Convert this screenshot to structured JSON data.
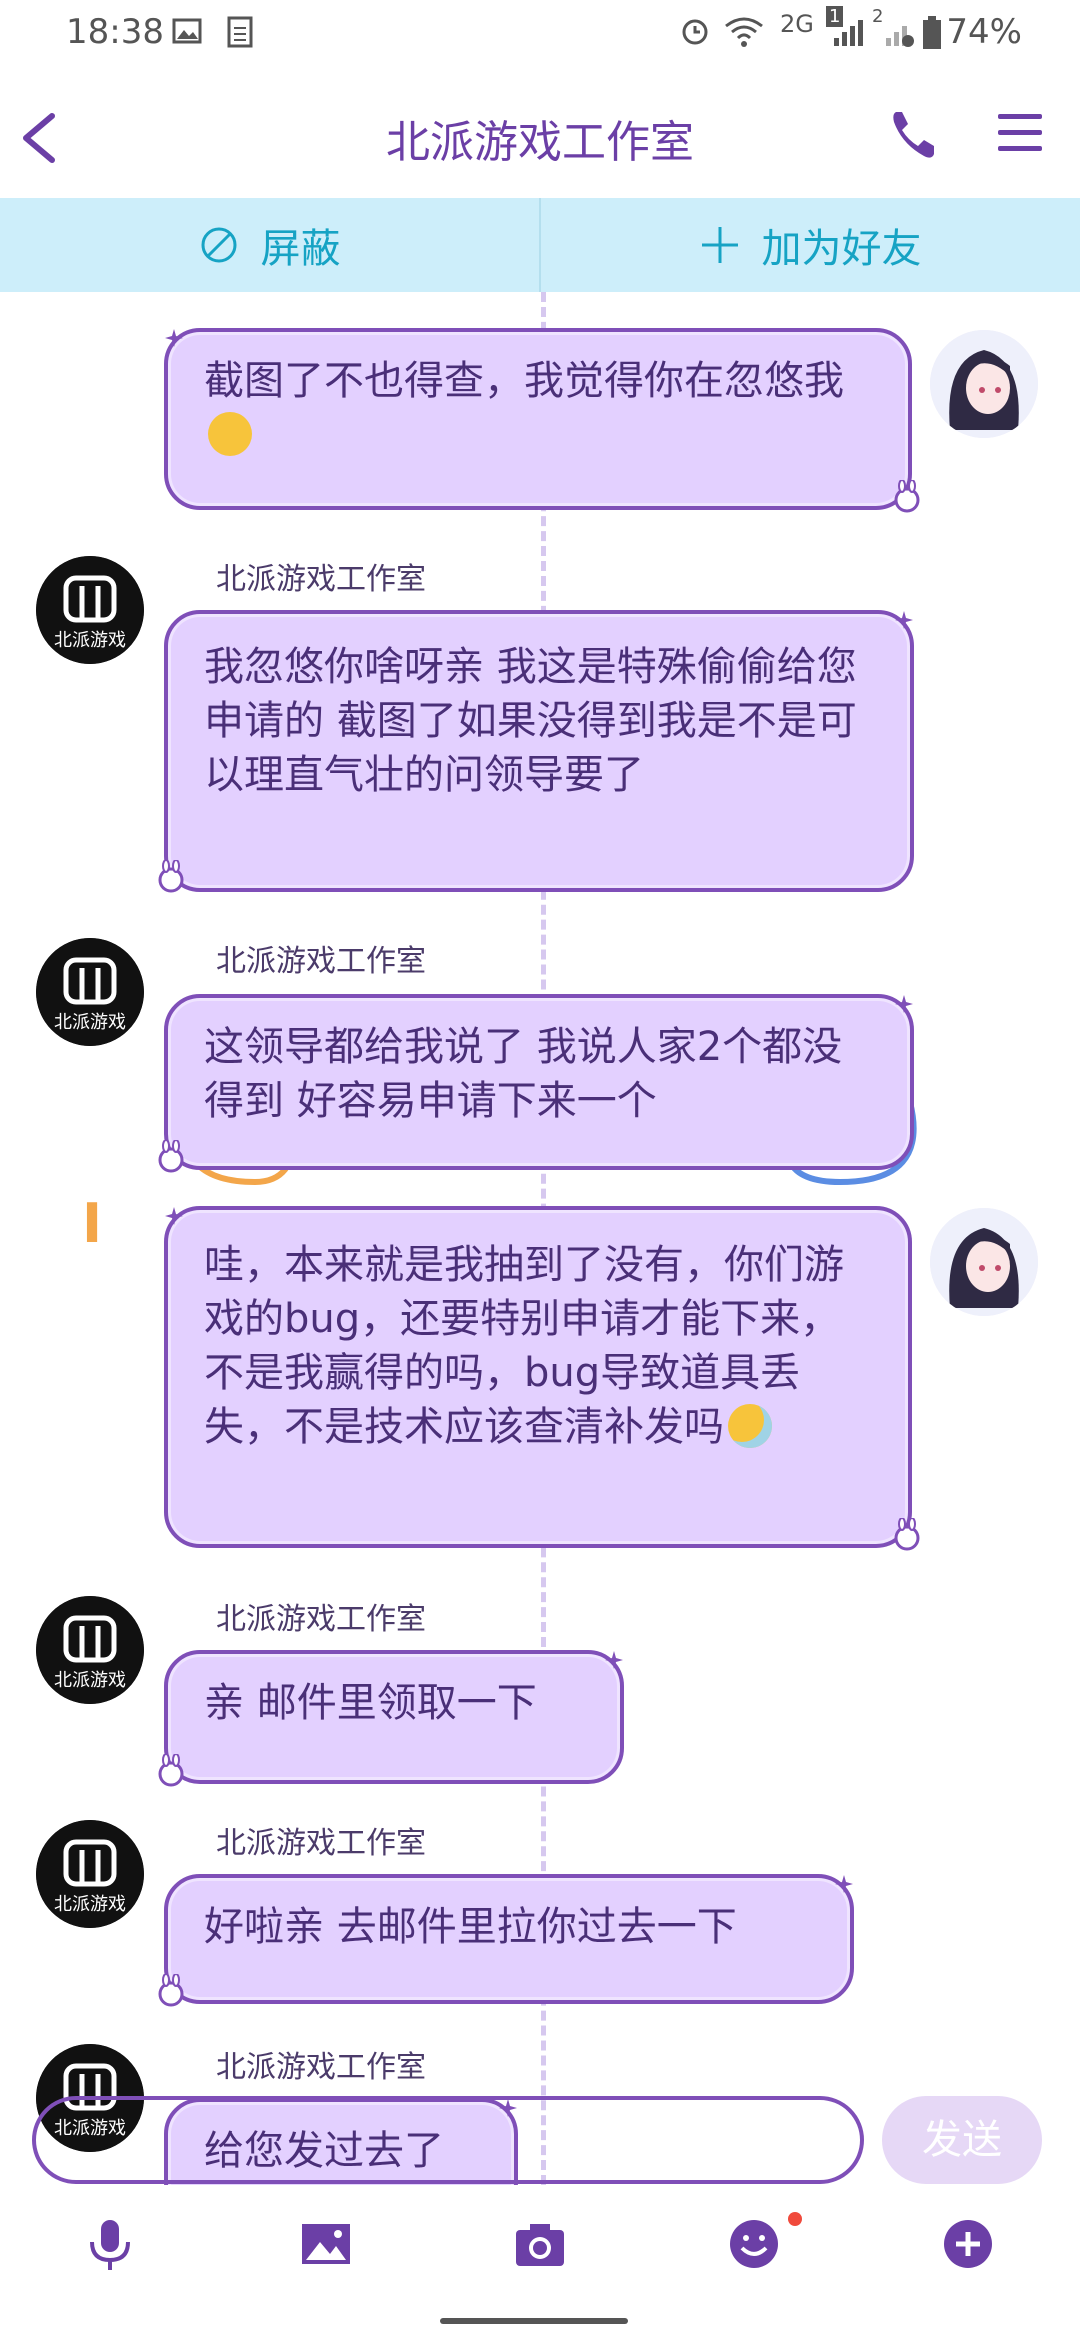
{
  "status": {
    "time": "18:38",
    "network": "2G",
    "sim": "1",
    "sim2": "2",
    "battery": "74%"
  },
  "header": {
    "title": "北派游戏工作室",
    "back_icon": "chevron-left-icon",
    "call_icon": "phone-icon",
    "menu_icon": "menu-icon"
  },
  "actions": {
    "block_label": "屏蔽",
    "add_friend_label": "加为好友"
  },
  "colors": {
    "accent": "#6b3fa6",
    "bubble_bg": "#e3d0ff",
    "bubble_border": "#7f4fb8",
    "action_bar_bg": "#cdeefa",
    "action_text": "#16a3c4"
  },
  "messages": [
    {
      "side": "right",
      "text": "截图了不也得查，我觉得你在忽悠我",
      "emoji": "dog-face-emoji"
    },
    {
      "side": "left",
      "sender": "北派游戏工作室",
      "text": "我忽悠你啥呀亲 我这是特殊偷偷给您申请的  截图了如果没得到我是不是可以理直气壮的问领导要了"
    },
    {
      "side": "left",
      "sender": "北派游戏工作室",
      "text": "这领导都给我说了  我说人家2个都没得到  好容易申请下来一个"
    },
    {
      "side": "right",
      "text": "哇，本来就是我抽到了没有，你们游戏的bug，还要特别申请才能下来，不是我赢得的吗，bug导致道具丢失，不是技术应该查清补发吗",
      "emoji": "sick-face-emoji"
    },
    {
      "side": "left",
      "sender": "北派游戏工作室",
      "text": "亲 邮件里领取一下"
    },
    {
      "side": "left",
      "sender": "北派游戏工作室",
      "text": "好啦亲 去邮件里拉你过去一下"
    },
    {
      "side": "left",
      "sender": "北派游戏工作室",
      "text": "给您发过去了"
    }
  ],
  "avatar_text": "北派游戏",
  "input": {
    "placeholder": "",
    "send_label": "发送"
  },
  "toolbar": {
    "mic": "microphone-icon",
    "image": "image-icon",
    "camera": "camera-icon",
    "emoji": "smiley-icon",
    "plus": "plus-circle-icon"
  }
}
